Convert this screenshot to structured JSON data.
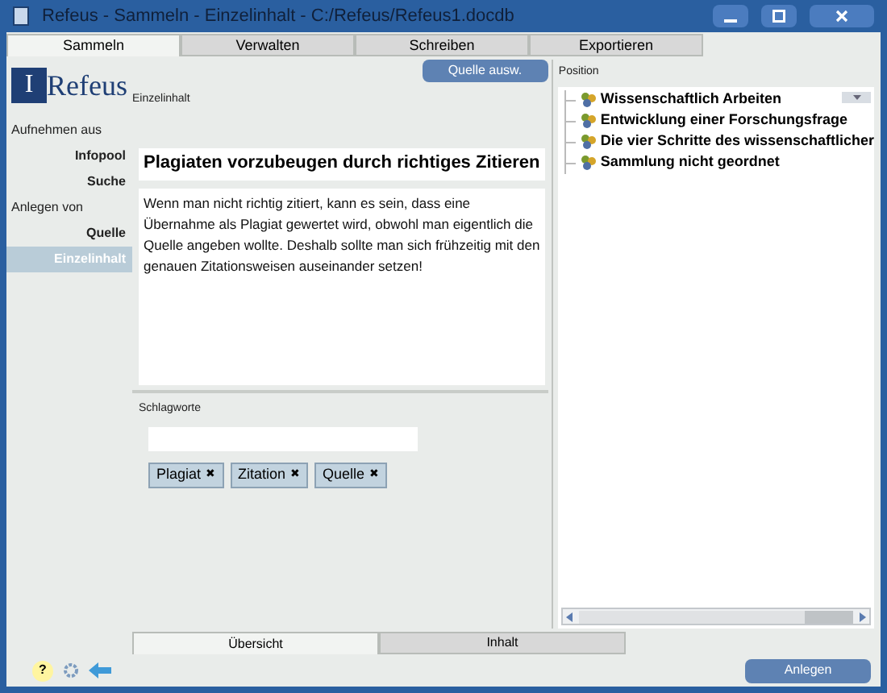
{
  "window": {
    "title": "Refeus - Sammeln - Einzelinhalt - C:/Refeus/Refeus1.docdb"
  },
  "tabs": [
    {
      "label": "Sammeln",
      "selected": true
    },
    {
      "label": "Verwalten",
      "selected": false
    },
    {
      "label": "Schreiben",
      "selected": false
    },
    {
      "label": "Exportieren",
      "selected": false
    }
  ],
  "logo": {
    "letter": "I",
    "text": "Refeus"
  },
  "sidebar": {
    "sections": [
      {
        "heading": "Aufnehmen aus",
        "items": [
          {
            "label": "Infopool",
            "selected": false
          },
          {
            "label": "Suche",
            "selected": false
          }
        ]
      },
      {
        "heading": "Anlegen von",
        "items": [
          {
            "label": "Quelle",
            "selected": false
          },
          {
            "label": "Einzelinhalt",
            "selected": true
          }
        ]
      }
    ]
  },
  "content": {
    "source_button": "Quelle ausw.",
    "section_label": "Einzelinhalt",
    "title": "Plagiaten vorzubeugen durch richtiges Zitieren",
    "body": "Wenn man nicht richtig zitiert, kann es sein, dass eine Übernahme als Plagiat gewertet wird, obwohl man eigentlich die Quelle angeben wollte. Deshalb sollte man sich frühzeitig mit den genauen Zitationsweisen auseinander setzen!",
    "keywords_label": "Schlagworte",
    "tags": [
      {
        "label": "Plagiat",
        "remove": "✖"
      },
      {
        "label": "Zitation",
        "remove": "✖"
      },
      {
        "label": "Quelle",
        "remove": "✖"
      }
    ]
  },
  "position": {
    "label": "Position",
    "tree": [
      {
        "label": "Wissenschaftlich Arbeiten"
      },
      {
        "label": "Entwicklung einer Forschungsfrage"
      },
      {
        "label": "Die vier Schritte des wissenschaftlicher"
      },
      {
        "label": "Sammlung nicht geordnet"
      }
    ]
  },
  "bottom_tabs": [
    {
      "label": "Übersicht",
      "selected": true
    },
    {
      "label": "Inhalt",
      "selected": false
    }
  ],
  "footer": {
    "help": "?",
    "create_button": "Anlegen"
  }
}
